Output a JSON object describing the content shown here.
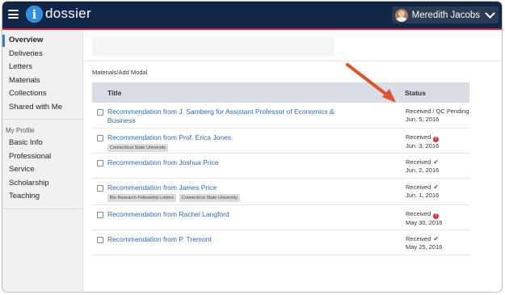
{
  "header": {
    "logo_text": "dossier",
    "user_name": "Meredith Jacobs"
  },
  "sidebar": {
    "items": [
      {
        "label": "Overview",
        "active": true
      },
      {
        "label": "Deliveries"
      },
      {
        "label": "Letters"
      },
      {
        "label": "Materials"
      },
      {
        "label": "Collections"
      },
      {
        "label": "Shared with Me"
      }
    ],
    "section_title": "My Profile",
    "profile_items": [
      {
        "label": "Basic Info"
      },
      {
        "label": "Professional"
      },
      {
        "label": "Service"
      },
      {
        "label": "Scholarship"
      },
      {
        "label": "Teaching"
      }
    ]
  },
  "main": {
    "breadcrumb": "Materials/Add Modal",
    "table": {
      "columns": [
        "Title",
        "Status"
      ],
      "rows": [
        {
          "title": "Recommendation from J. Samberg for Assistant Professor of Economics & Business",
          "tags": [],
          "status": "Received / QC Pending",
          "status_icon": "",
          "date": "Jun. 5, 2016"
        },
        {
          "title": "Recommendation from Prof. Erica Jones",
          "tags": [
            "Connecticut State University"
          ],
          "status": "Received",
          "status_icon": "!",
          "date": "Jun. 3, 2016"
        },
        {
          "title": "Recommendation from Joshua Price",
          "tags": [],
          "status": "Received",
          "status_icon": "✔",
          "date": "Jun. 2, 2016"
        },
        {
          "title": "Recommendation from James Price",
          "tags": [
            "Bio Research Fellowship Letters",
            "Connecticut State University"
          ],
          "status": "Received",
          "status_icon": "✔",
          "date": "Jun. 1, 2016"
        },
        {
          "title": "Recommendation from Rachel Langford",
          "tags": [],
          "status": "Received",
          "status_icon": "!",
          "date": "May 30, 2016"
        },
        {
          "title": "Recommendation from P. Tremont",
          "tags": [],
          "status": "Received",
          "status_icon": "✔",
          "date": "May 25, 2016"
        }
      ]
    }
  },
  "colors": {
    "topbar": "#122648",
    "accent_line": "#d2233e",
    "link": "#2b6cb4",
    "annotation_arrow": "#e0522a"
  }
}
